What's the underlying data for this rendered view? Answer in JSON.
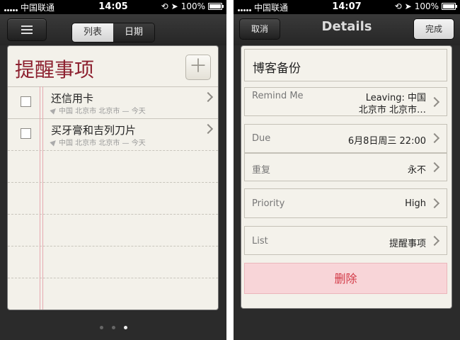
{
  "left": {
    "status": {
      "carrier": "中国联通",
      "time": "14:05",
      "battery": "100%"
    },
    "nav": {
      "tabs": [
        "列表",
        "日期"
      ]
    },
    "list_title": "提醒事项",
    "reminders": [
      {
        "title": "还信用卡",
        "meta": "中国 北京市 北京市 — 今天"
      },
      {
        "title": "买牙膏和吉列刀片",
        "meta": "中国 北京市 北京市 — 今天"
      }
    ]
  },
  "right": {
    "status": {
      "carrier": "中国联通",
      "time": "14:07",
      "battery": "100%"
    },
    "nav": {
      "cancel": "取消",
      "title": "Details",
      "done": "完成"
    },
    "title_field": "博客备份",
    "remind_me": {
      "label": "Remind Me",
      "value_line1": "Leaving: 中国",
      "value_line2": "北京市 北京市…"
    },
    "due": {
      "label": "Due",
      "value": "6月8日周三  22:00"
    },
    "repeat": {
      "label": "重复",
      "value": "永不"
    },
    "priority": {
      "label": "Priority",
      "value": "High"
    },
    "list": {
      "label": "List",
      "value": "提醒事项"
    },
    "delete": "删除"
  }
}
